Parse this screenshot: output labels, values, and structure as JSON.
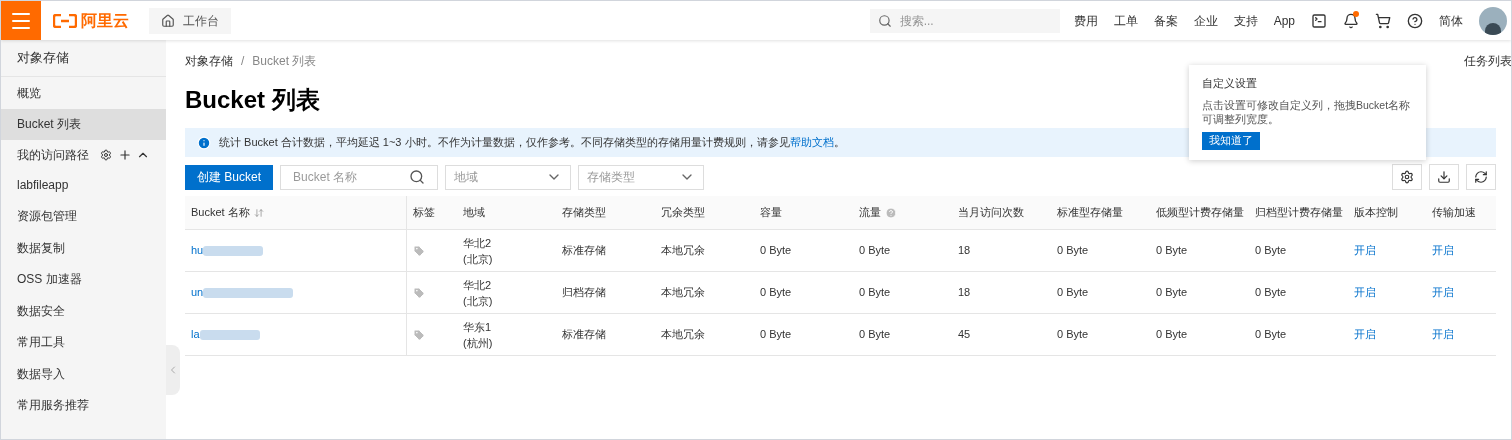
{
  "topbar": {
    "logo": "阿里云",
    "workbench": "工作台",
    "search": {
      "placeholder": "搜索..."
    },
    "links": [
      "费用",
      "工单",
      "备案",
      "企业",
      "支持",
      "App"
    ],
    "notification_dot": true,
    "language": "简体"
  },
  "sidebar": {
    "title": "对象存储",
    "items": [
      {
        "label": "概览",
        "selected": false,
        "kind": "link"
      },
      {
        "label": "Bucket 列表",
        "selected": true,
        "kind": "link"
      },
      {
        "label": "我的访问路径",
        "selected": false,
        "kind": "section"
      },
      {
        "label": "labfileapp",
        "selected": false,
        "kind": "link"
      },
      {
        "label": "资源包管理",
        "selected": false,
        "kind": "link"
      },
      {
        "label": "数据复制",
        "selected": false,
        "kind": "link"
      },
      {
        "label": "OSS 加速器",
        "selected": false,
        "kind": "link"
      },
      {
        "label": "数据安全",
        "selected": false,
        "kind": "link"
      },
      {
        "label": "常用工具",
        "selected": false,
        "kind": "link"
      },
      {
        "label": "数据导入",
        "selected": false,
        "kind": "link"
      },
      {
        "label": "常用服务推荐",
        "selected": false,
        "kind": "link"
      }
    ]
  },
  "breadcrumb": [
    "对象存储",
    "Bucket 列表"
  ],
  "breadcrumb_separator": "/",
  "task_list": "任务列表",
  "title": "Bucket 列表",
  "notice": {
    "text": "统计 Bucket 合计数据，平均延迟 1~3 小时。不作为计量数据，仅作参考。不同存储类型的存储用量计费规则，请参见",
    "link": "帮助文档",
    "end": "。"
  },
  "toolbar": {
    "create": "创建 Bucket",
    "name_filter": {
      "placeholder": "Bucket 名称"
    },
    "region_filter": {
      "placeholder": "地域"
    },
    "type_filter": {
      "placeholder": "存储类型"
    }
  },
  "popover": {
    "title": "自定义设置",
    "text": "点击设置可修改自定义列，拖拽Bucket名称可调整列宽度。",
    "button": "我知道了"
  },
  "table": {
    "columns": [
      "Bucket 名称",
      "标签",
      "地域",
      "存储类型",
      "冗余类型",
      "容量",
      "流量",
      "当月访问次数",
      "标准型存储量",
      "低频型计费存储量",
      "归档型计费存储量",
      "版本控制",
      "传输加速"
    ],
    "rows": [
      {
        "name": "hu",
        "region": "华北2",
        "city": "(北京)",
        "storage": "标准存储",
        "redundancy": "本地冗余",
        "capacity": "0 Byte",
        "traffic": "0 Byte",
        "visits": "18",
        "standard": "0 Byte",
        "ia": "0 Byte",
        "archive": "0 Byte",
        "versioning": "开启",
        "acceleration": "开启"
      },
      {
        "name": "un",
        "region": "华北2",
        "city": "(北京)",
        "storage": "归档存储",
        "redundancy": "本地冗余",
        "capacity": "0 Byte",
        "traffic": "0 Byte",
        "visits": "18",
        "standard": "0 Byte",
        "ia": "0 Byte",
        "archive": "0 Byte",
        "versioning": "开启",
        "acceleration": "开启"
      },
      {
        "name": "la",
        "region": "华东1",
        "city": "(杭州)",
        "storage": "标准存储",
        "redundancy": "本地冗余",
        "capacity": "0 Byte",
        "traffic": "0 Byte",
        "visits": "45",
        "standard": "0 Byte",
        "ia": "0 Byte",
        "archive": "0 Byte",
        "versioning": "开启",
        "acceleration": "开启"
      }
    ]
  }
}
